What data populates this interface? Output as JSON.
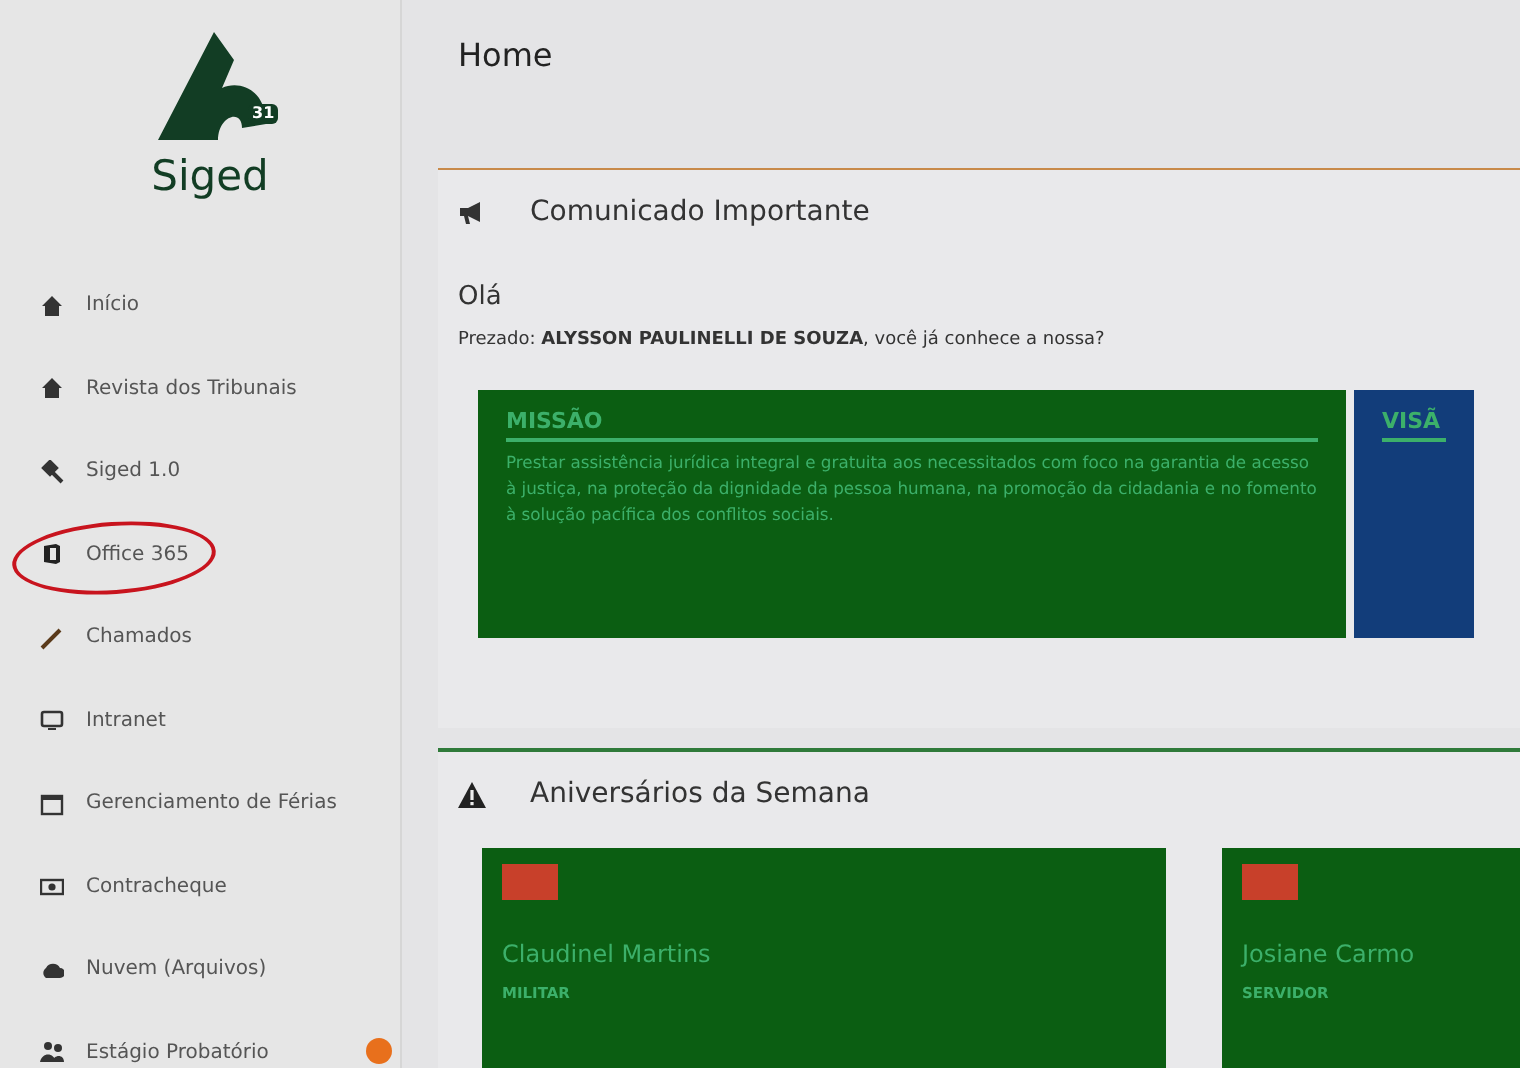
{
  "sidebar": {
    "logo_text": "Siged",
    "logo_mark": "31",
    "items": [
      {
        "label": "Início",
        "highlighted": false,
        "badge": false
      },
      {
        "label": "Revista dos Tribunais",
        "highlighted": false,
        "badge": false
      },
      {
        "label": "Siged 1.0",
        "highlighted": false,
        "badge": false
      },
      {
        "label": "Office 365",
        "highlighted": true,
        "badge": false
      },
      {
        "label": "Chamados",
        "highlighted": false,
        "badge": false
      },
      {
        "label": "Intranet",
        "highlighted": false,
        "badge": false
      },
      {
        "label": "Gerenciamento de Férias",
        "highlighted": false,
        "badge": false
      },
      {
        "label": "Contracheque",
        "highlighted": false,
        "badge": false
      },
      {
        "label": "Nuvem (Arquivos)",
        "highlighted": false,
        "badge": false
      },
      {
        "label": "Estágio Probatório",
        "highlighted": false,
        "badge": true
      }
    ]
  },
  "page_title": "Home",
  "notice": {
    "title": "Comunicado Importante",
    "greeting": "Olá",
    "message": "Prezado: **ALYSSON PAULINELLI DE SOUZA**, você já conhece a nossa?",
    "cards": [
      {
        "title": "MISSÃO",
        "color": "#0b5e12",
        "text": "Prestar assistência jurídica integral e gratuita aos necessitados com foco na garantia de acesso à justiça, na proteção da dignidade da pessoa humana, na promoção da cidadania e no fomento à solução pacífica dos conflitos sociais."
      },
      {
        "title": "VISÃ",
        "color": "#123d7a"
      }
    ]
  },
  "birthdays": {
    "title": "Aniversários da Semana",
    "people": [
      {
        "name": "Claudinel Martins",
        "role": "MILITAR"
      },
      {
        "name": "Josiane Carmo",
        "role": "SERVIDOR"
      }
    ]
  }
}
